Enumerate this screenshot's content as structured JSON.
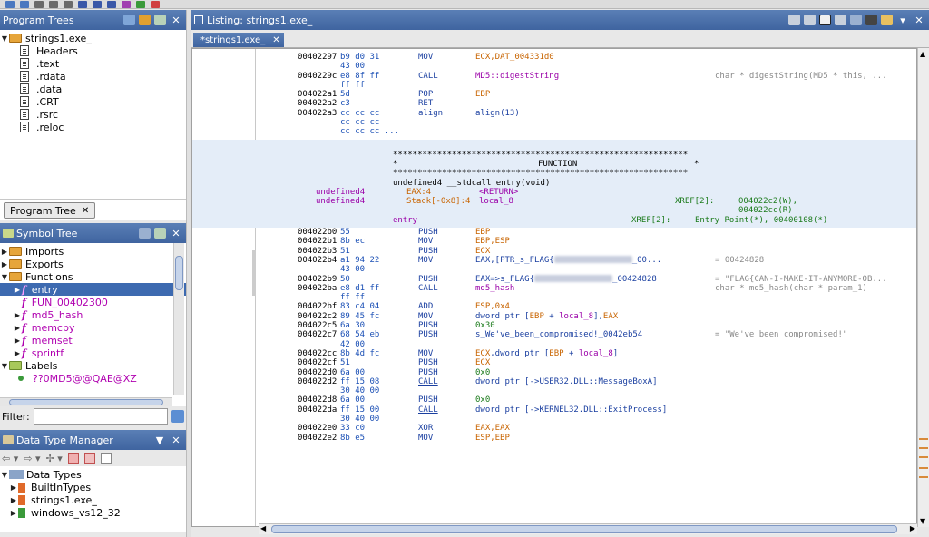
{
  "program_trees": {
    "title": "Program Trees",
    "root": "strings1.exe_",
    "sections": [
      "Headers",
      ".text",
      ".rdata",
      ".data",
      ".CRT",
      ".rsrc",
      ".reloc"
    ],
    "tab_label": "Program Tree"
  },
  "symbol_tree": {
    "title": "Symbol Tree",
    "groups": [
      "Imports",
      "Exports",
      "Functions",
      "Labels"
    ],
    "functions": [
      "entry",
      "FUN_00402300",
      "md5_hash",
      "memcpy",
      "memset",
      "sprintf"
    ],
    "label_item": "??0MD5@@QAE@XZ"
  },
  "filter": {
    "label": "Filter:"
  },
  "data_type_manager": {
    "title": "Data Type Manager",
    "root": "Data Types",
    "items": [
      "BuiltInTypes",
      "strings1.exe_",
      "windows_vs12_32"
    ]
  },
  "listing": {
    "title": "Listing:  strings1.exe_",
    "tab": "*strings1.exe_",
    "lines": [
      {
        "addr": "00402297",
        "bytes": "b9 d0 31",
        "mnem": "MOV",
        "op": "ECX,DAT_004331d0",
        "op_color": "orange",
        "cmt": ""
      },
      {
        "addr": "",
        "bytes": "43 00",
        "mnem": "",
        "op": "",
        "cmt": ""
      },
      {
        "addr": "0040229c",
        "bytes": "e8 8f ff",
        "mnem": "CALL",
        "op": "MD5::digestString",
        "op_color": "purple",
        "cmt": "char * digestString(MD5 * this, ..."
      },
      {
        "addr": "",
        "bytes": "ff ff",
        "mnem": "",
        "op": "",
        "cmt": ""
      },
      {
        "addr": "004022a1",
        "bytes": "5d",
        "mnem": "POP",
        "op": "EBP",
        "op_color": "orange",
        "cmt": ""
      },
      {
        "addr": "004022a2",
        "bytes": "c3",
        "mnem": "RET",
        "op": "",
        "cmt": ""
      },
      {
        "addr": "004022a3",
        "bytes": "cc cc cc",
        "mnem": "align",
        "op": "align(13)",
        "cmt": ""
      },
      {
        "addr": "",
        "bytes": "cc cc cc",
        "mnem": "",
        "op": "",
        "cmt": ""
      },
      {
        "addr": "",
        "bytes": "cc cc cc ...",
        "mnem": "",
        "op": "",
        "cmt": ""
      }
    ],
    "func_header": {
      "stars": "************************************************************",
      "star": "*",
      "function": "FUNCTION",
      "signature": "undefined4 __stdcall entry(void)",
      "p1_type": "undefined4",
      "p1_loc": "EAX:4",
      "p1_name": "<RETURN>",
      "p2_type": "undefined4",
      "p2_loc": "Stack[-0x8]:4",
      "p2_name": "local_8",
      "xref1": "XREF[2]:",
      "xref1_a": "004022c2(W),",
      "xref1_b": "004022cc(R)",
      "label": "entry",
      "xref2": "XREF[2]:",
      "xref2_val": "Entry Point(*), 00400108(*)"
    },
    "lines2": [
      {
        "addr": "004022b0",
        "bytes": "55",
        "mnem": "PUSH",
        "op": "EBP",
        "op_color": "orange",
        "cmt": ""
      },
      {
        "addr": "004022b1",
        "bytes": "8b ec",
        "mnem": "MOV",
        "op": "EBP,ESP",
        "op_color": "orange",
        "cmt": ""
      },
      {
        "addr": "004022b3",
        "bytes": "51",
        "mnem": "PUSH",
        "op": "ECX",
        "op_color": "orange",
        "cmt": ""
      },
      {
        "addr": "004022b4",
        "bytes": "a1 94 22",
        "mnem": "MOV",
        "op": "EAX,[PTR_s_FLAG{",
        "op_tail": "_00...",
        "blur": true,
        "op_color": "blue",
        "cmt": "= 00424828"
      },
      {
        "addr": "",
        "bytes": "43 00",
        "mnem": "",
        "op": "",
        "cmt": ""
      },
      {
        "addr": "004022b9",
        "bytes": "50",
        "mnem": "PUSH",
        "op": "EAX=>s_FLAG{",
        "op_tail": "_00424828",
        "blur": true,
        "op_color": "blue",
        "cmt": "= \"FLAG{CAN-I-MAKE-IT-ANYMORE-OB..."
      },
      {
        "addr": "004022ba",
        "bytes": "e8 d1 ff",
        "mnem": "CALL",
        "op": "md5_hash",
        "op_color": "purple",
        "cmt": "char * md5_hash(char * param_1)"
      },
      {
        "addr": "",
        "bytes": "ff ff",
        "mnem": "",
        "op": "",
        "cmt": ""
      },
      {
        "addr": "004022bf",
        "bytes": "83 c4 04",
        "mnem": "ADD",
        "op": "ESP,0x4",
        "op_color": "orange",
        "cmt": ""
      },
      {
        "addr": "004022c2",
        "bytes": "89 45 fc",
        "mnem": "MOV",
        "op": "dword ptr [EBP + local_8],EAX",
        "op_color": "mixed",
        "cmt": ""
      },
      {
        "addr": "004022c5",
        "bytes": "6a 30",
        "mnem": "PUSH",
        "op": "0x30",
        "op_color": "green",
        "cmt": ""
      },
      {
        "addr": "004022c7",
        "bytes": "68 54 eb",
        "mnem": "PUSH",
        "op": "s_We've_been_compromised!_0042eb54",
        "op_color": "blue",
        "cmt": "= \"We've been compromised!\""
      },
      {
        "addr": "",
        "bytes": "42 00",
        "mnem": "",
        "op": "",
        "cmt": ""
      },
      {
        "addr": "004022cc",
        "bytes": "8b 4d fc",
        "mnem": "MOV",
        "op": "ECX,dword ptr [EBP + local_8]",
        "op_color": "mixed",
        "cmt": ""
      },
      {
        "addr": "004022cf",
        "bytes": "51",
        "mnem": "PUSH",
        "op": "ECX",
        "op_color": "orange",
        "cmt": ""
      },
      {
        "addr": "004022d0",
        "bytes": "6a 00",
        "mnem": "PUSH",
        "op": "0x0",
        "op_color": "green",
        "cmt": ""
      },
      {
        "addr": "004022d2",
        "bytes": "ff 15 08",
        "mnem": "CALL",
        "op": "dword ptr [->USER32.DLL::MessageBoxA]",
        "op_color": "blue",
        "mnem_ul": true,
        "cmt": ""
      },
      {
        "addr": "",
        "bytes": "30 40 00",
        "mnem": "",
        "op": "",
        "cmt": ""
      },
      {
        "addr": "004022d8",
        "bytes": "6a 00",
        "mnem": "PUSH",
        "op": "0x0",
        "op_color": "green",
        "cmt": ""
      },
      {
        "addr": "004022da",
        "bytes": "ff 15 00",
        "mnem": "CALL",
        "op": "dword ptr [->KERNEL32.DLL::ExitProcess]",
        "op_color": "blue",
        "mnem_ul": true,
        "cmt": ""
      },
      {
        "addr": "",
        "bytes": "30 40 00",
        "mnem": "",
        "op": "",
        "cmt": ""
      },
      {
        "addr": "004022e0",
        "bytes": "33 c0",
        "mnem": "XOR",
        "op": "EAX,EAX",
        "op_color": "orange",
        "cmt": ""
      },
      {
        "addr": "004022e2",
        "bytes": "8b e5",
        "mnem": "MOV",
        "op": "ESP,EBP",
        "op_color": "orange",
        "cmt": ""
      }
    ]
  }
}
